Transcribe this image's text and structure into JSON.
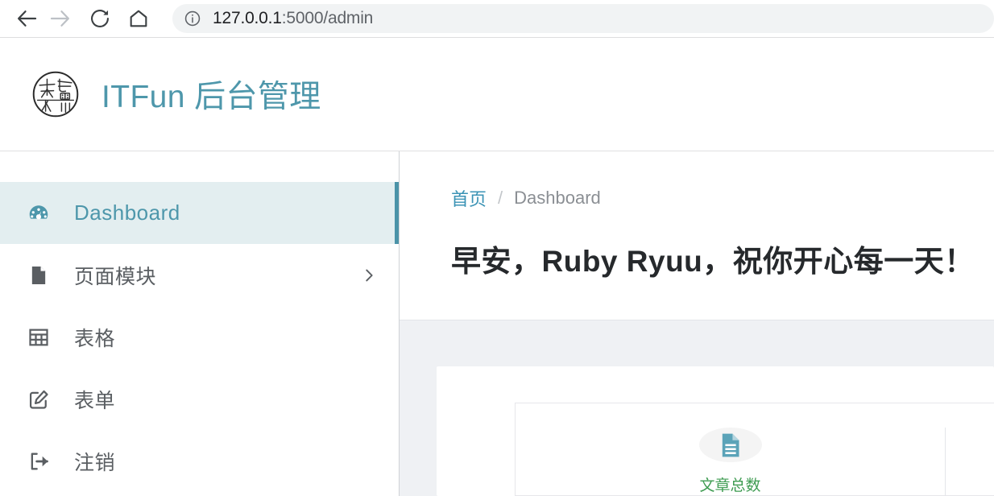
{
  "browser": {
    "back_icon": "arrow-left-icon",
    "forward_icon": "arrow-right-icon",
    "reload_icon": "reload-icon",
    "home_icon": "home-icon",
    "info_icon": "info-circle-icon",
    "url_host": "127.0.0.1",
    "url_path": ":5000/admin",
    "url_full": "127.0.0.1:5000/admin"
  },
  "header": {
    "logo_icon": "itfun-seal-logo",
    "title": "ITFun 后台管理",
    "brand_color": "#4e97ab"
  },
  "sidebar": {
    "items": [
      {
        "label": "Dashboard",
        "icon": "tachometer-icon",
        "active": true,
        "chevron": ""
      },
      {
        "label": "页面模块",
        "icon": "file-icon",
        "active": false,
        "chevron": "chevron-right-icon"
      },
      {
        "label": "表格",
        "icon": "table-icon",
        "active": false,
        "chevron": ""
      },
      {
        "label": "表单",
        "icon": "edit-icon",
        "active": false,
        "chevron": ""
      },
      {
        "label": "注销",
        "icon": "logout-icon",
        "active": false,
        "chevron": ""
      }
    ],
    "active_bg": "#e3eef0",
    "active_accent": "#4b93a8"
  },
  "main": {
    "breadcrumb": {
      "home": "首页",
      "separator": "/",
      "current": "Dashboard"
    },
    "greeting": "早安，Ruby Ryuu，祝你开心每一天！",
    "card": {
      "columns": [
        {
          "icon": "file-alt-icon",
          "label": "文章总数",
          "color": "#3f9c52"
        }
      ]
    }
  }
}
